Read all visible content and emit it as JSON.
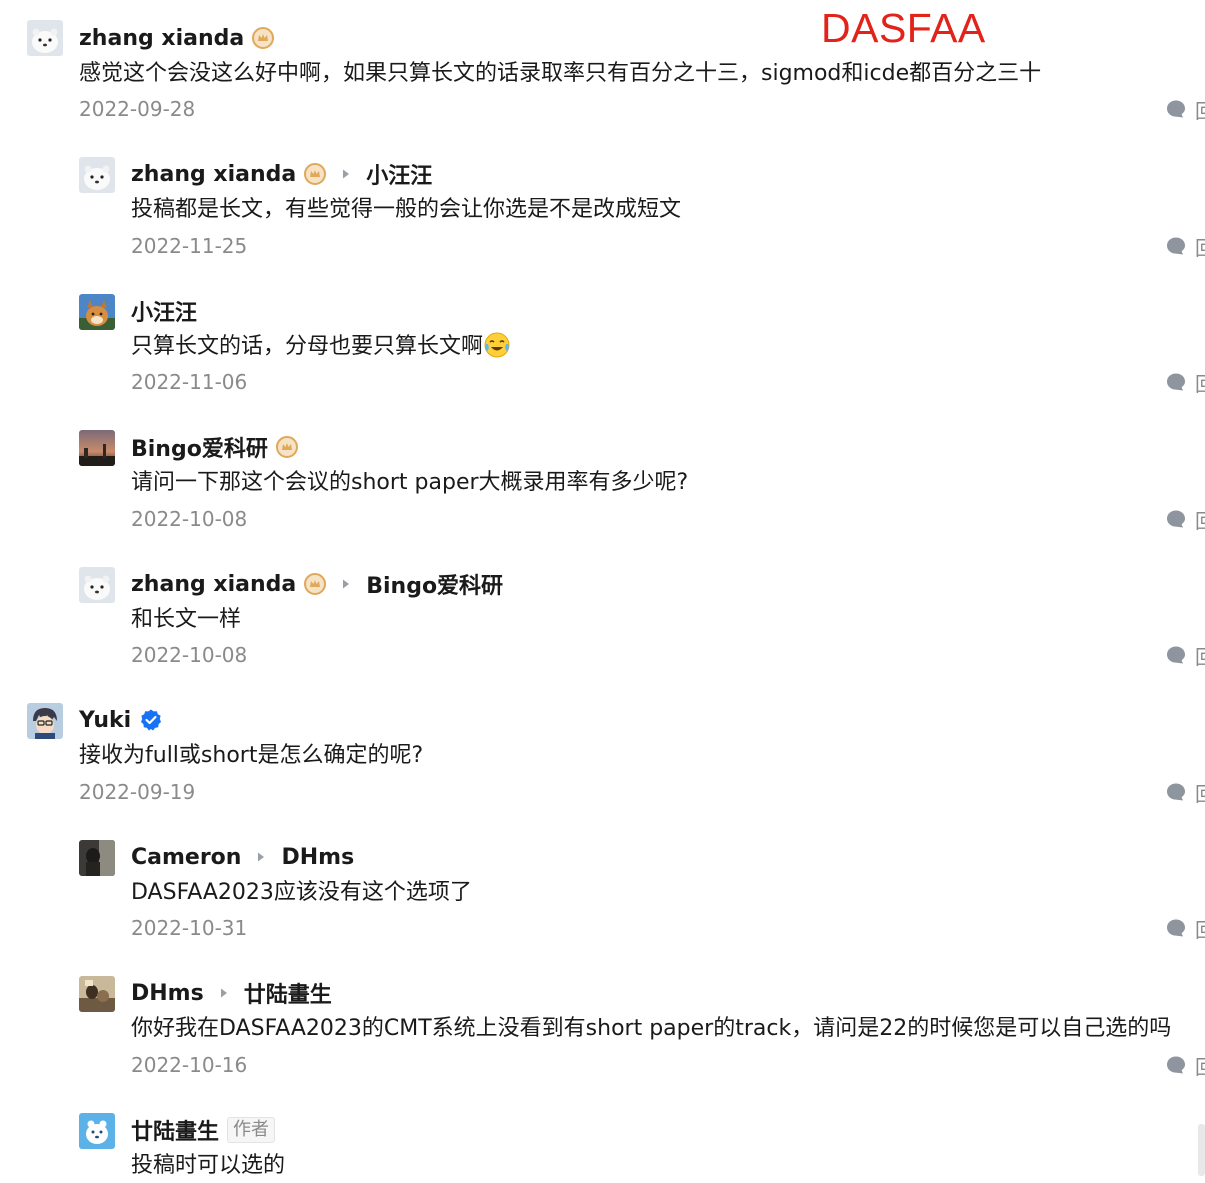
{
  "overlay_title": "DASFAA",
  "reply_label": "回复",
  "comments": [
    {
      "author": "zhang xianda",
      "content": "感觉这个会没这么好中啊，如果只算长文的话录取率只有百分之十三，sigmod和icde都百分之三十",
      "date": "2022-09-28"
    },
    {
      "author": "zhang xianda",
      "reply_to": "小汪汪",
      "content": "投稿都是长文，有些觉得一般的会让你选是不是改成短文",
      "date": "2022-11-25"
    },
    {
      "author": "小汪汪",
      "content": "只算长文的话，分母也要只算长文啊",
      "date": "2022-11-06"
    },
    {
      "author": "Bingo爱科研",
      "content": "请问一下那这个会议的short paper大概录用率有多少呢?",
      "date": "2022-10-08"
    },
    {
      "author": "zhang xianda",
      "reply_to": "Bingo爱科研",
      "content": "和长文一样",
      "date": "2022-10-08"
    },
    {
      "author": "Yuki",
      "content": "接收为full或short是怎么确定的呢?",
      "date": "2022-09-19"
    },
    {
      "author": "Cameron",
      "reply_to": "DHms",
      "content": "DASFAA2023应该没有这个选项了",
      "date": "2022-10-31"
    },
    {
      "author": "DHms",
      "reply_to": "廿陆畫生",
      "content": "你好我在DASFAA2023的CMT系统上没看到有short paper的track，请问是22的时候您是可以自己选的吗",
      "date": "2022-10-16"
    },
    {
      "author": "廿陆畫生",
      "author_tag": "作者",
      "content": "投稿时可以选的"
    }
  ],
  "icons": {
    "comment": "comment-bubble-icon",
    "gold_badge": "gold-crown-badge-icon",
    "verified": "verified-badge-icon",
    "reply_arrow": "reply-arrow-icon",
    "emoji": "laughing-crying-emoji-icon"
  },
  "colors": {
    "overlay_title": "#e2231a",
    "date": "#8a8a8a",
    "verified": "#1772f6",
    "gold_badge": "#e0a85a"
  }
}
